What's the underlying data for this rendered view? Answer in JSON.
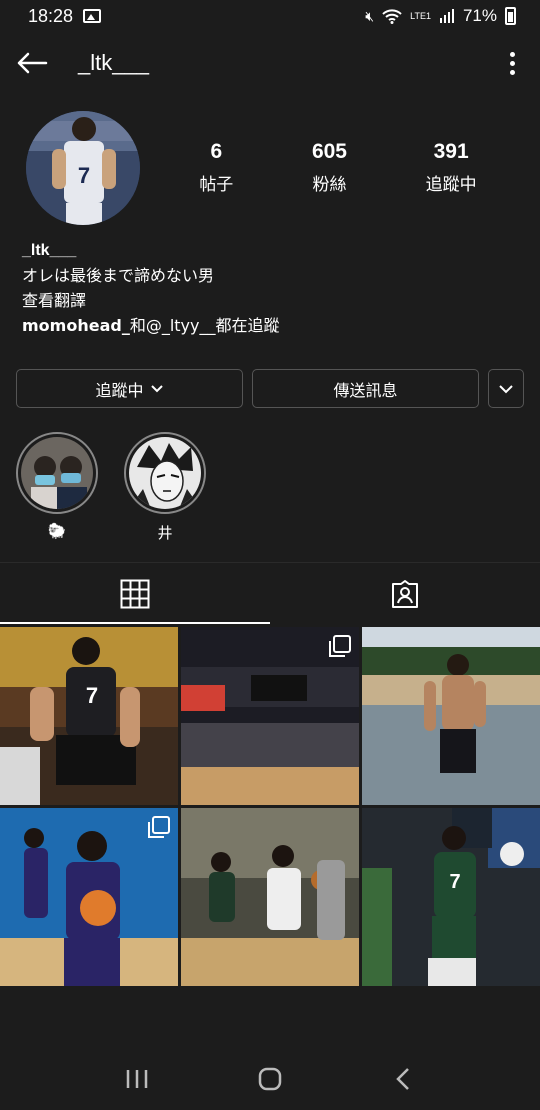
{
  "status": {
    "time": "18:28",
    "battery": "71%",
    "network": "LTE1"
  },
  "header": {
    "username": "_ltk___"
  },
  "stats": [
    {
      "value": "6",
      "label": "帖子"
    },
    {
      "value": "605",
      "label": "粉絲"
    },
    {
      "value": "391",
      "label": "追蹤中"
    }
  ],
  "bio": {
    "name": "_ltk___",
    "text": "オレは最後まで諦めない男",
    "translate": "查看翻譯",
    "followed_by_user": "momohead_",
    "followed_by_mid": "和@_ltyy__都在追蹤"
  },
  "buttons": {
    "following": "追蹤中",
    "message": "傳送訊息"
  },
  "highlights": [
    {
      "caption": "🐑"
    },
    {
      "caption": "井"
    }
  ],
  "colors": {
    "background": "#1c1c1c",
    "text": "#ffffff",
    "border": "#555555"
  }
}
